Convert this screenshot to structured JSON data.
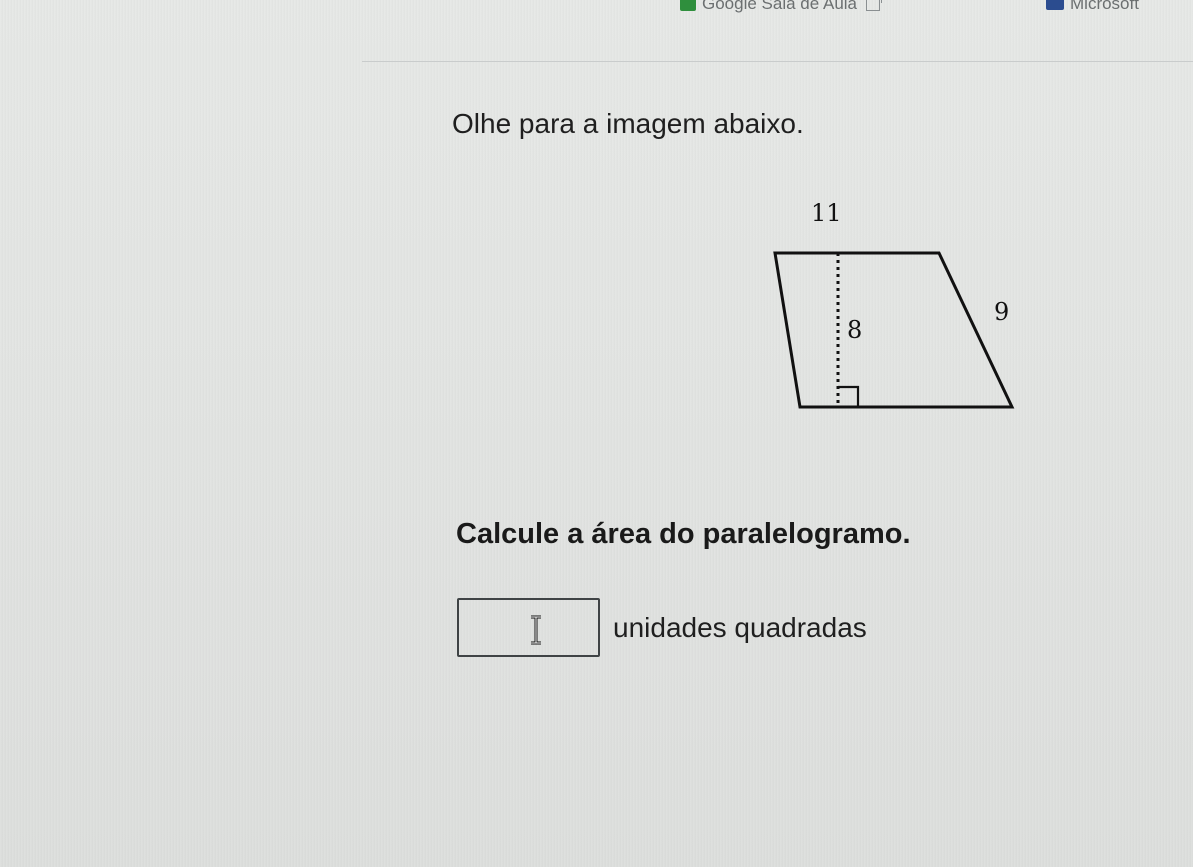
{
  "topbar": {
    "classroom_label": "Google Sala de Aula",
    "microsoft_label": "Microsoft"
  },
  "question": {
    "text": "Olhe para a imagem abaixo."
  },
  "figure": {
    "top_label": "11",
    "height_label": "8",
    "side_label": "9"
  },
  "prompt": {
    "text": "Calcule a área do paralelogramo."
  },
  "answer": {
    "value": "",
    "placeholder": "",
    "unit_label": "unidades quadradas"
  }
}
